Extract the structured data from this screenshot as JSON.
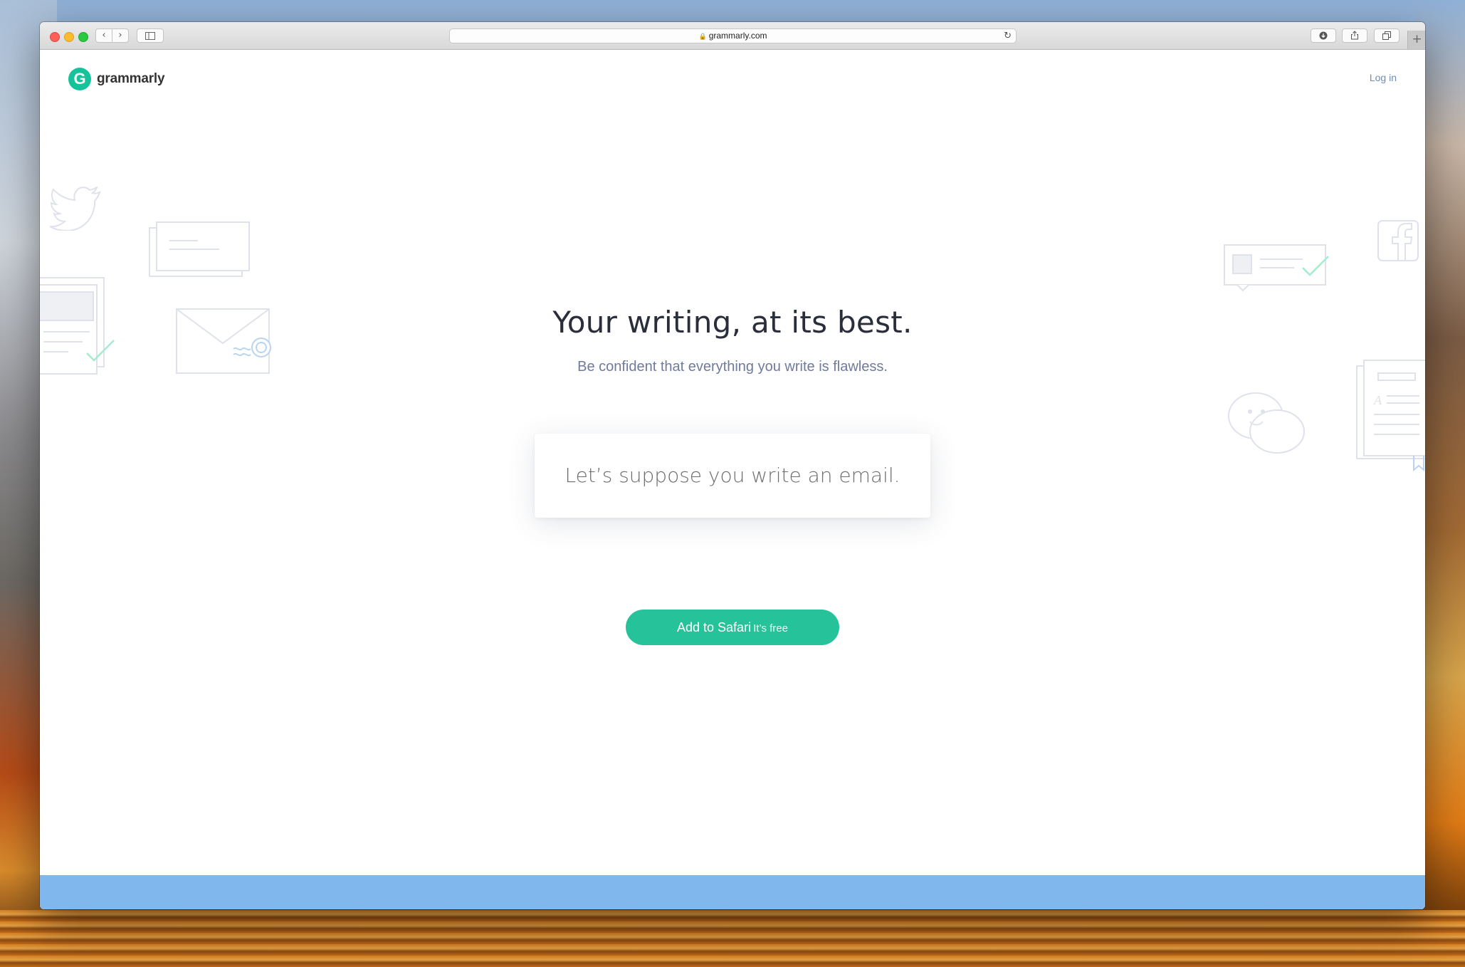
{
  "browser": {
    "url": "grammarly.com",
    "back_glyph": "‹",
    "forward_glyph": "›",
    "reload_glyph": "↻",
    "new_tab_glyph": "+"
  },
  "header": {
    "logo_letter": "G",
    "logo_text": "grammarly",
    "login_label": "Log in"
  },
  "hero": {
    "headline": "Your writing, at its best.",
    "subhead": "Be confident that everything you write is flawless.",
    "card_text": "Let’s suppose you write an email."
  },
  "cta": {
    "label": "Add to Safari",
    "sublabel": "It’s free"
  },
  "colors": {
    "brand": "#15c39a",
    "cta": "#26c29a",
    "band": "#80b7ec",
    "link": "#6f8bb6"
  }
}
